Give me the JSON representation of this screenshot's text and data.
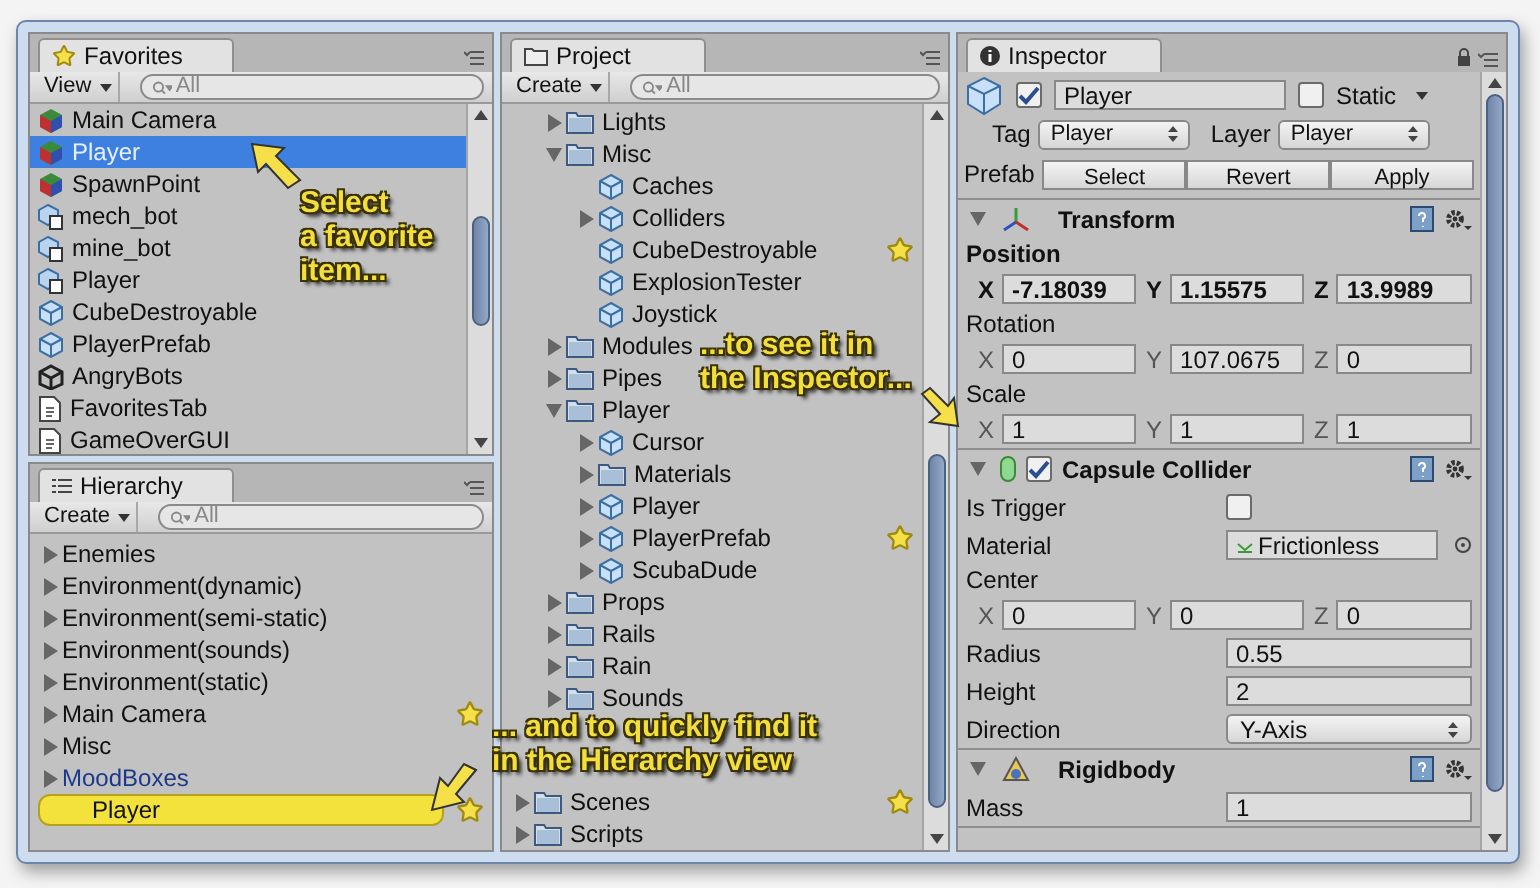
{
  "favorites": {
    "tab": "Favorites",
    "view_button": "View",
    "search": {
      "placeholder": "All"
    },
    "items": [
      {
        "label": "Main Camera",
        "kind": "gameobject",
        "selected": false
      },
      {
        "label": "Player",
        "kind": "gameobject",
        "selected": true
      },
      {
        "label": "SpawnPoint",
        "kind": "gameobject",
        "selected": false
      },
      {
        "label": "mech_bot",
        "kind": "model",
        "selected": false
      },
      {
        "label": "mine_bot",
        "kind": "model",
        "selected": false
      },
      {
        "label": "Player",
        "kind": "model",
        "selected": false
      },
      {
        "label": "CubeDestroyable",
        "kind": "prefab",
        "selected": false
      },
      {
        "label": "PlayerPrefab",
        "kind": "prefab",
        "selected": false
      },
      {
        "label": "AngryBots",
        "kind": "scene",
        "selected": false
      },
      {
        "label": "FavoritesTab",
        "kind": "script",
        "selected": false
      },
      {
        "label": "GameOverGUI",
        "kind": "script",
        "selected": false
      }
    ]
  },
  "hierarchy": {
    "tab": "Hierarchy",
    "create_button": "Create",
    "search": {
      "placeholder": "All"
    },
    "items": [
      {
        "label": "Enemies",
        "kind": "object",
        "expanded": false,
        "favorite": false,
        "selected": false
      },
      {
        "label": "Environment(dynamic)",
        "kind": "object",
        "expanded": false,
        "favorite": false,
        "selected": false
      },
      {
        "label": "Environment(semi-static)",
        "kind": "object",
        "expanded": false,
        "favorite": false,
        "selected": false
      },
      {
        "label": "Environment(sounds)",
        "kind": "object",
        "expanded": false,
        "favorite": false,
        "selected": false
      },
      {
        "label": "Environment(static)",
        "kind": "object",
        "expanded": false,
        "favorite": false,
        "selected": false
      },
      {
        "label": "Main Camera",
        "kind": "object",
        "expanded": false,
        "favorite": true,
        "selected": false
      },
      {
        "label": "Misc",
        "kind": "object",
        "expanded": false,
        "favorite": false,
        "selected": false
      },
      {
        "label": "MoodBoxes",
        "kind": "prefab",
        "expanded": false,
        "favorite": false,
        "selected": false
      },
      {
        "label": "Player",
        "kind": "object",
        "favorite": true,
        "selected": true
      }
    ]
  },
  "project": {
    "tab": "Project",
    "create_button": "Create",
    "search": {
      "placeholder": "All"
    },
    "items": [
      {
        "label": "Lights",
        "kind": "folder",
        "expanded": false,
        "favorite": false
      },
      {
        "label": "Misc",
        "kind": "folder",
        "expanded": true,
        "favorite": false,
        "children": [
          {
            "label": "Caches",
            "kind": "prefab",
            "favorite": false
          },
          {
            "label": "Colliders",
            "kind": "prefab",
            "expanded": false,
            "favorite": false
          },
          {
            "label": "CubeDestroyable",
            "kind": "prefab",
            "favorite": true
          },
          {
            "label": "ExplosionTester",
            "kind": "prefab",
            "favorite": false
          },
          {
            "label": "Joystick",
            "kind": "prefab",
            "favorite": false
          }
        ]
      },
      {
        "label": "Modules",
        "kind": "folder",
        "expanded": false,
        "favorite": false
      },
      {
        "label": "Pipes",
        "kind": "folder",
        "expanded": false,
        "favorite": false
      },
      {
        "label": "Player",
        "kind": "folder",
        "expanded": true,
        "favorite": false,
        "children": [
          {
            "label": "Cursor",
            "kind": "prefab",
            "expanded": false,
            "favorite": false
          },
          {
            "label": "Materials",
            "kind": "folder",
            "expanded": false,
            "favorite": false
          },
          {
            "label": "Player",
            "kind": "prefab",
            "expanded": false,
            "favorite": false
          },
          {
            "label": "PlayerPrefab",
            "kind": "prefab",
            "expanded": false,
            "favorite": true
          },
          {
            "label": "ScubaDude",
            "kind": "prefab",
            "expanded": false,
            "favorite": false
          }
        ]
      },
      {
        "label": "Props",
        "kind": "folder",
        "expanded": false,
        "favorite": false
      },
      {
        "label": "Rails",
        "kind": "folder",
        "expanded": false,
        "favorite": false
      },
      {
        "label": "Rain",
        "kind": "folder",
        "expanded": false,
        "favorite": false
      },
      {
        "label": "Sounds",
        "kind": "folder",
        "expanded": false,
        "favorite": false
      }
    ],
    "outer_items": [
      {
        "label": "Scenes",
        "kind": "folder",
        "expanded": false,
        "favorite": true
      },
      {
        "label": "Scripts",
        "kind": "folder",
        "expanded": false,
        "favorite": false
      }
    ]
  },
  "inspector": {
    "tab": "Inspector",
    "active": true,
    "name": "Player",
    "static": {
      "label": "Static",
      "checked": false
    },
    "tag": {
      "label": "Tag",
      "value": "Player"
    },
    "layer": {
      "label": "Layer",
      "value": "Player"
    },
    "prefab": {
      "label": "Prefab",
      "buttons": [
        "Select",
        "Revert",
        "Apply"
      ]
    },
    "components": [
      {
        "title": "Transform",
        "kind": "transform",
        "expanded": true,
        "rows": [
          {
            "kind": "vector",
            "label": "Position",
            "overridden": true,
            "axes": [
              {
                "axis": "X",
                "value": "-7.18039"
              },
              {
                "axis": "Y",
                "value": "1.15575"
              },
              {
                "axis": "Z",
                "value": "13.9989"
              }
            ]
          },
          {
            "kind": "vector",
            "label": "Rotation",
            "overridden": false,
            "axes": [
              {
                "axis": "X",
                "value": "0"
              },
              {
                "axis": "Y",
                "value": "107.0675"
              },
              {
                "axis": "Z",
                "value": "0"
              }
            ]
          },
          {
            "kind": "vector",
            "label": "Scale",
            "overridden": false,
            "axes": [
              {
                "axis": "X",
                "value": "1"
              },
              {
                "axis": "Y",
                "value": "1"
              },
              {
                "axis": "Z",
                "value": "1"
              }
            ]
          }
        ]
      },
      {
        "title": "Capsule Collider",
        "kind": "collider",
        "expanded": true,
        "enabled": true,
        "rows": [
          {
            "kind": "checkbox",
            "label": "Is Trigger",
            "checked": false
          },
          {
            "kind": "object",
            "label": "Material",
            "value": "Frictionless"
          },
          {
            "kind": "vector",
            "label": "Center",
            "overridden": false,
            "axes": [
              {
                "axis": "X",
                "value": "0"
              },
              {
                "axis": "Y",
                "value": "0"
              },
              {
                "axis": "Z",
                "value": "0"
              }
            ]
          },
          {
            "kind": "text",
            "label": "Radius",
            "value": "0.55"
          },
          {
            "kind": "text",
            "label": "Height",
            "value": "2"
          },
          {
            "kind": "dropdown",
            "label": "Direction",
            "value": "Y-Axis"
          }
        ]
      },
      {
        "title": "Rigidbody",
        "kind": "rigidbody",
        "expanded": true,
        "rows": [
          {
            "kind": "text",
            "label": "Mass",
            "value": "1"
          }
        ]
      }
    ]
  },
  "callouts": [
    {
      "lines": [
        "Select",
        "a favorite",
        "item..."
      ]
    },
    {
      "lines": [
        "...to see it in",
        "the Inspector..."
      ]
    },
    {
      "lines": [
        "... and to quickly find it",
        "in the Hierarchy view"
      ]
    }
  ]
}
